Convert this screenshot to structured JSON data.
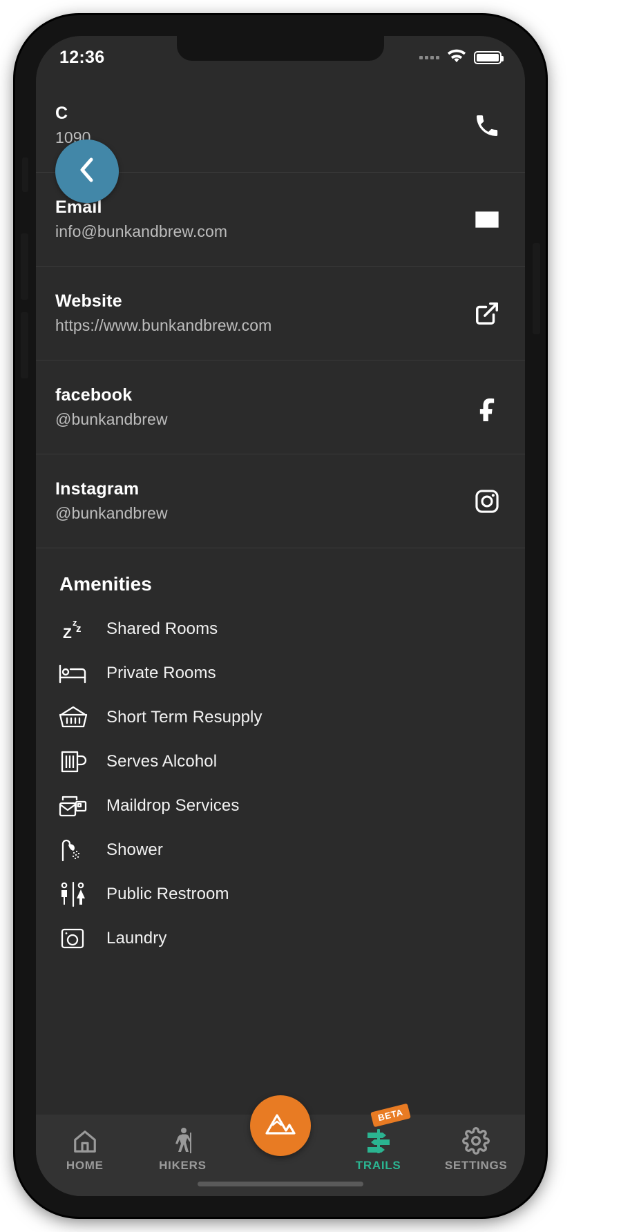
{
  "status_bar": {
    "time": "12:36",
    "signal_icon": "signal-dots-icon",
    "wifi_icon": "wifi-icon",
    "battery_icon": "battery-full-icon"
  },
  "back_button": {
    "icon": "chevron-left-icon",
    "color": "#4287a8"
  },
  "contact_rows": [
    {
      "title": "C",
      "value": "1090",
      "icon": "phone-icon",
      "name": "phone"
    },
    {
      "title": "Email",
      "value": "info@bunkandbrew.com",
      "icon": "envelope-icon",
      "name": "email"
    },
    {
      "title": "Website",
      "value": "https://www.bunkandbrew.com",
      "icon": "external-link-icon",
      "name": "website"
    },
    {
      "title": "facebook",
      "value": "@bunkandbrew",
      "icon": "facebook-icon",
      "name": "facebook"
    },
    {
      "title": "Instagram",
      "value": "@bunkandbrew",
      "icon": "instagram-icon",
      "name": "instagram"
    }
  ],
  "amenities": {
    "heading": "Amenities",
    "items": [
      {
        "label": "Shared Rooms",
        "icon": "sleep-zzz-icon"
      },
      {
        "label": "Private Rooms",
        "icon": "bed-icon"
      },
      {
        "label": "Short Term Resupply",
        "icon": "basket-icon"
      },
      {
        "label": "Serves Alcohol",
        "icon": "beer-mug-icon"
      },
      {
        "label": "Maildrop Services",
        "icon": "mail-package-icon"
      },
      {
        "label": "Shower",
        "icon": "shower-icon"
      },
      {
        "label": "Public Restroom",
        "icon": "restroom-icon"
      },
      {
        "label": "Laundry",
        "icon": "laundry-icon"
      }
    ]
  },
  "tabbar": {
    "tabs": [
      {
        "label": "HOME",
        "icon": "home-icon",
        "active": false
      },
      {
        "label": "HIKERS",
        "icon": "hiker-icon",
        "active": false
      },
      {
        "label": "TRAILS",
        "icon": "signpost-icon",
        "active": true,
        "badge": "BETA"
      },
      {
        "label": "SETTINGS",
        "icon": "gear-icon",
        "active": false
      }
    ],
    "center_button": {
      "icon": "mountain-icon",
      "color": "#e87b23"
    },
    "active_color": "#2bb491",
    "inactive_color": "#9a9a9a"
  }
}
